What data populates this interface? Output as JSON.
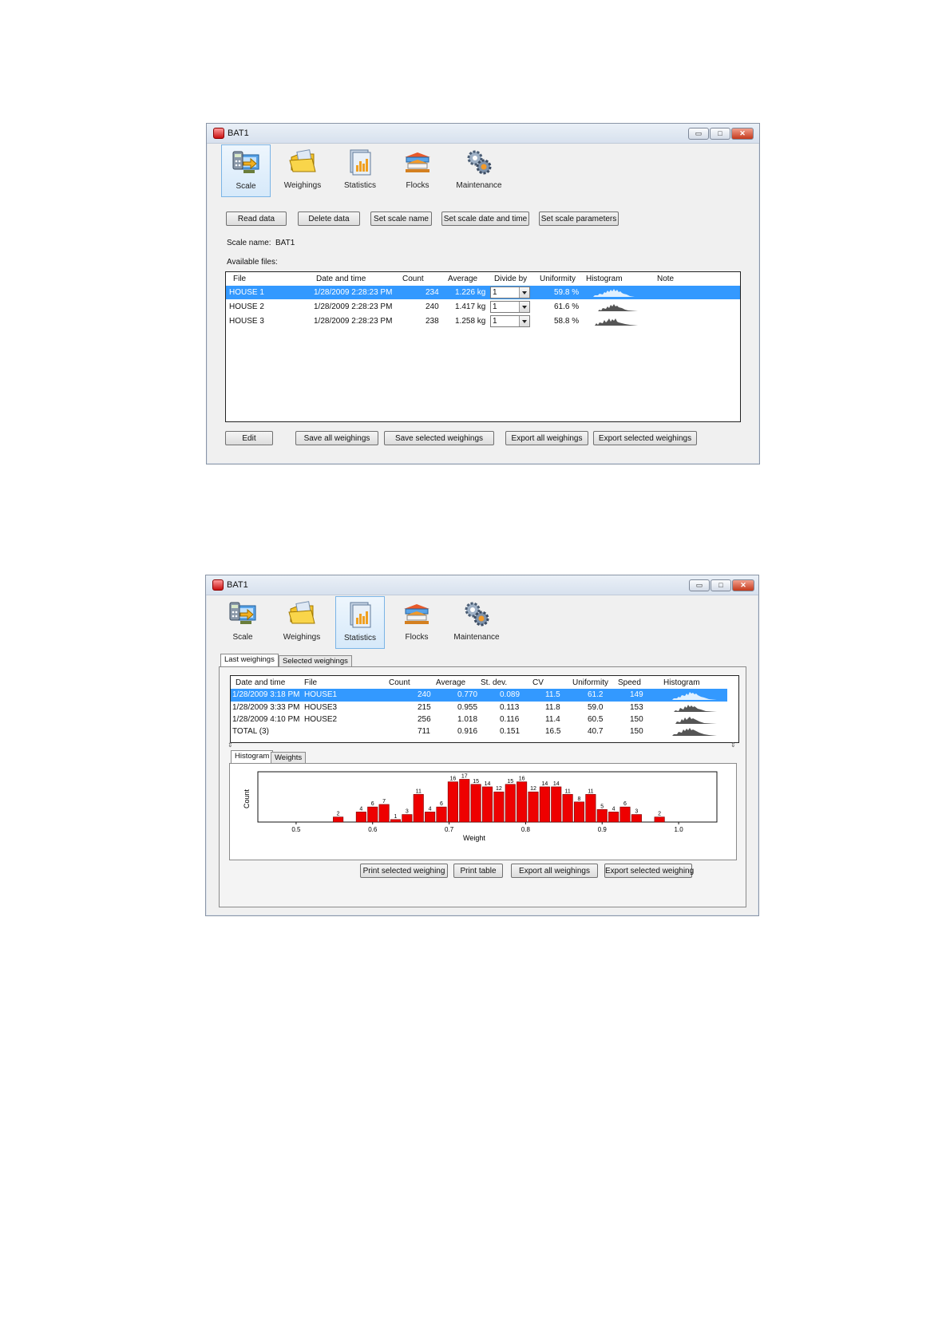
{
  "window1": {
    "title": "BAT1",
    "buttons": {
      "minimize": "▭",
      "maximize": "□",
      "close": "✕"
    },
    "toolbar": [
      {
        "label": "Scale",
        "icon": "scale-icon",
        "active": true
      },
      {
        "label": "Weighings",
        "icon": "weighings-folder-icon",
        "active": false
      },
      {
        "label": "Statistics",
        "icon": "statistics-chart-icon",
        "active": false
      },
      {
        "label": "Flocks",
        "icon": "flocks-house-icon",
        "active": false
      },
      {
        "label": "Maintenance",
        "icon": "maintenance-gears-icon",
        "active": false
      }
    ],
    "actions": [
      "Read data",
      "Delete data",
      "Set scale name",
      "Set scale date and time",
      "Set scale parameters"
    ],
    "scale_name_label": "Scale name:",
    "scale_name_value": "BAT1",
    "available_files_label": "Available files:",
    "columns": [
      "File",
      "Date and time",
      "Count",
      "Average",
      "Divide by",
      "Uniformity",
      "Histogram",
      "Note"
    ],
    "rows": [
      {
        "file": "HOUSE 1",
        "datetime": "1/28/2009 2:28:23 PM",
        "count": "234",
        "average": "1.226 kg",
        "divide": "1",
        "uniformity": "59.8 %",
        "selected": true
      },
      {
        "file": "HOUSE 2",
        "datetime": "1/28/2009 2:28:23 PM",
        "count": "240",
        "average": "1.417 kg",
        "divide": "1",
        "uniformity": "61.6 %",
        "selected": false
      },
      {
        "file": "HOUSE 3",
        "datetime": "1/28/2009 2:28:23 PM",
        "count": "238",
        "average": "1.258 kg",
        "divide": "1",
        "uniformity": "58.8 %",
        "selected": false
      }
    ],
    "bottom_buttons": [
      "Edit",
      "Save all weighings",
      "Save selected weighings",
      "Export all weighings",
      "Export selected weighings"
    ]
  },
  "window2": {
    "title": "BAT1",
    "buttons": {
      "minimize": "▭",
      "maximize": "□",
      "close": "✕"
    },
    "toolbar": [
      {
        "label": "Scale",
        "icon": "scale-icon",
        "active": false
      },
      {
        "label": "Weighings",
        "icon": "weighings-folder-icon",
        "active": false
      },
      {
        "label": "Statistics",
        "icon": "statistics-chart-icon",
        "active": true
      },
      {
        "label": "Flocks",
        "icon": "flocks-house-icon",
        "active": false
      },
      {
        "label": "Maintenance",
        "icon": "maintenance-gears-icon",
        "active": false
      }
    ],
    "tabs": [
      "Last weighings",
      "Selected weighings"
    ],
    "columns": [
      "Date and time",
      "File",
      "Count",
      "Average",
      "St. dev.",
      "CV",
      "Uniformity",
      "Speed",
      "Histogram"
    ],
    "rows": [
      {
        "datetime": "1/28/2009 3:18 PM",
        "file": "HOUSE1",
        "count": "240",
        "average": "0.770",
        "stdev": "0.089",
        "cv": "11.5",
        "uniformity": "61.2",
        "speed": "149",
        "selected": true
      },
      {
        "datetime": "1/28/2009 3:33 PM",
        "file": "HOUSE3",
        "count": "215",
        "average": "0.955",
        "stdev": "0.113",
        "cv": "11.8",
        "uniformity": "59.0",
        "speed": "153",
        "selected": false
      },
      {
        "datetime": "1/28/2009 4:10 PM",
        "file": "HOUSE2",
        "count": "256",
        "average": "1.018",
        "stdev": "0.116",
        "cv": "11.4",
        "uniformity": "60.5",
        "speed": "150",
        "selected": false
      },
      {
        "datetime": "TOTAL (3)",
        "file": "",
        "count": "711",
        "average": "0.916",
        "stdev": "0.151",
        "cv": "16.5",
        "uniformity": "40.7",
        "speed": "150",
        "selected": false
      }
    ],
    "subtabs": [
      "Histogram",
      "Weights"
    ],
    "bottom_buttons": [
      "Print selected weighing",
      "Print table",
      "Export all weighings",
      "Export selected weighing"
    ]
  },
  "chart_data": {
    "type": "bar",
    "xlabel": "Weight",
    "ylabel": "Count",
    "xlim": [
      0.45,
      1.05
    ],
    "x_ticks": [
      0.5,
      0.6,
      0.7,
      0.8,
      0.9,
      1.0
    ],
    "x_tick_labels": [
      "0.5",
      "0.6",
      "0.7",
      "0.8",
      "0.9",
      "1.0"
    ],
    "bar_color": "#ee0000",
    "x": [
      0.555,
      0.585,
      0.6,
      0.615,
      0.63,
      0.645,
      0.66,
      0.675,
      0.69,
      0.705,
      0.72,
      0.735,
      0.75,
      0.765,
      0.78,
      0.795,
      0.81,
      0.825,
      0.84,
      0.855,
      0.87,
      0.885,
      0.9,
      0.915,
      0.93,
      0.945,
      0.96,
      0.975
    ],
    "values": [
      2,
      4,
      6,
      7,
      1,
      3,
      11,
      4,
      6,
      16,
      17,
      15,
      14,
      12,
      15,
      16,
      12,
      14,
      14,
      11,
      8,
      11,
      5,
      4,
      6,
      3,
      0,
      2
    ],
    "labels": [
      "2",
      "4",
      "6",
      "7",
      "1",
      "3",
      "11",
      "4",
      "6",
      "16",
      "17",
      "15",
      "14",
      "12",
      "15",
      "16",
      "12",
      "14",
      "14",
      "11",
      "8",
      "11",
      "5",
      "4",
      "6",
      "3",
      "",
      "2"
    ]
  }
}
